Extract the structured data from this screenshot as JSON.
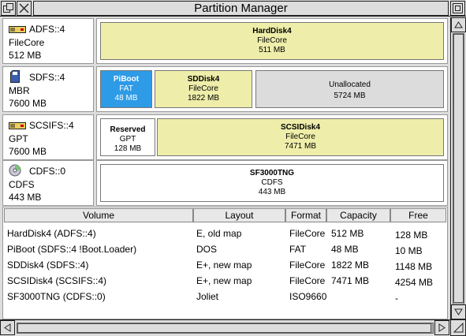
{
  "window": {
    "title": "Partition Manager",
    "back_icon": "back-icon",
    "close_icon": "close-icon",
    "toggle_icon": "toggle-size-icon"
  },
  "disks": [
    {
      "name": "ADFS::4",
      "scheme": "FileCore",
      "size": "512 MB",
      "icon": "hard-disk-icon",
      "partitions": [
        {
          "name": "HardDisk4",
          "type": "FileCore",
          "size": "511 MB"
        }
      ]
    },
    {
      "name": "SDFS::4",
      "scheme": "MBR",
      "size": "7600 MB",
      "icon": "sd-card-icon",
      "partitions": [
        {
          "name": "PiBoot",
          "type": "FAT",
          "size": "48 MB"
        },
        {
          "name": "SDDisk4",
          "type": "FileCore",
          "size": "1822 MB"
        },
        {
          "name": "",
          "type": "Unallocated",
          "size": "5724 MB"
        }
      ]
    },
    {
      "name": "SCSIFS::4",
      "scheme": "GPT",
      "size": "7600 MB",
      "icon": "hard-disk-icon",
      "partitions": [
        {
          "name": "Reserved",
          "type": "GPT",
          "size": "128 MB"
        },
        {
          "name": "SCSIDisk4",
          "type": "FileCore",
          "size": "7471 MB"
        }
      ]
    },
    {
      "name": "CDFS::0",
      "scheme": "CDFS",
      "size": "443 MB",
      "icon": "cd-icon",
      "partitions": [
        {
          "name": "SF3000TNG",
          "type": "CDFS",
          "size": "443 MB"
        }
      ]
    }
  ],
  "table": {
    "headers": [
      "Volume",
      "Layout",
      "Format",
      "Capacity",
      "Free"
    ],
    "rows": [
      [
        "HardDisk4 (ADFS::4)",
        "E, old map",
        "FileCore",
        "512 MB",
        "128 MB"
      ],
      [
        "PiBoot (SDFS::4 !Boot.Loader)",
        "DOS",
        "FAT",
        "48 MB",
        "10 MB"
      ],
      [
        "SDDisk4 (SDFS::4)",
        "E+, new map",
        "FileCore",
        "1822 MB",
        "1148 MB"
      ],
      [
        "SCSIDisk4 (SCSIFS::4)",
        "E+, new map",
        "FileCore",
        "7471 MB",
        "4254 MB"
      ],
      [
        "SF3000TNG (CDFS::0)",
        "Joliet",
        "ISO9660",
        "",
        "-"
      ]
    ]
  },
  "colors": {
    "fat_partition": "#2e9be6",
    "filecore_partition": "#eeeeaa",
    "unallocated_partition": "#dcdcdc"
  }
}
